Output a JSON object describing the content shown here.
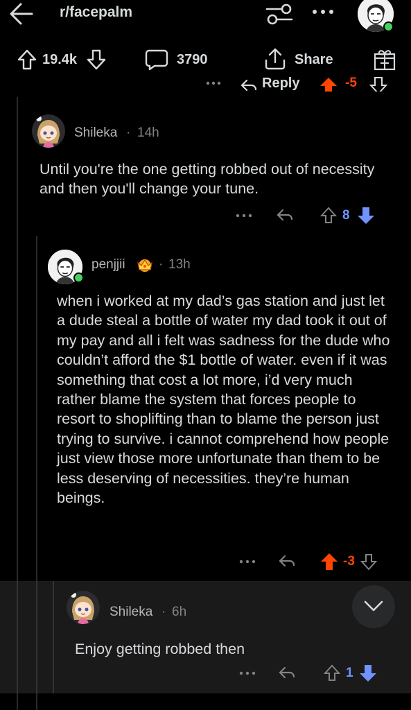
{
  "header": {
    "subreddit": "r/facepalm",
    "back_icon": "arrow-left-icon",
    "filter_icon": "sliders-icon",
    "more_icon": "more-horizontal-icon"
  },
  "post_bar": {
    "upvotes": "19.4k",
    "comments": "3790",
    "share_label": "Share"
  },
  "partial_row": {
    "reply_label": "Reply",
    "score": "-5"
  },
  "comments": [
    {
      "username": "Shileka",
      "time": "14h",
      "text": "Until you're the one getting robbed out of necessity and then you'll change your tune.",
      "score": "8",
      "vote_state": "downvoted"
    },
    {
      "username": "penjjii",
      "time": "13h",
      "text": "when i worked at my dad’s gas station and just let a dude steal a bottle of water my dad took it out of my pay and all i felt was sadness for the dude who couldn’t afford the $1 bottle of water. even if it was something that cost a lot more, i’d very much rather blame the system that forces people to resort to shoplifting than to blame the person just trying to survive. i cannot comprehend how people just view those more unfortunate than them to be less deserving of necessities. they’re human beings.",
      "score": "-3",
      "vote_state": "upvoted"
    },
    {
      "username": "Shileka",
      "time": "6h",
      "text": "Enjoy getting robbed then",
      "score": "1",
      "vote_state": "downvoted"
    }
  ],
  "colors": {
    "background": "#000000",
    "highlight_background": "#1a1a1b",
    "upvote_orange": "#ff4500",
    "downvote_blue": "#7193ff",
    "online_green": "#46d160"
  }
}
